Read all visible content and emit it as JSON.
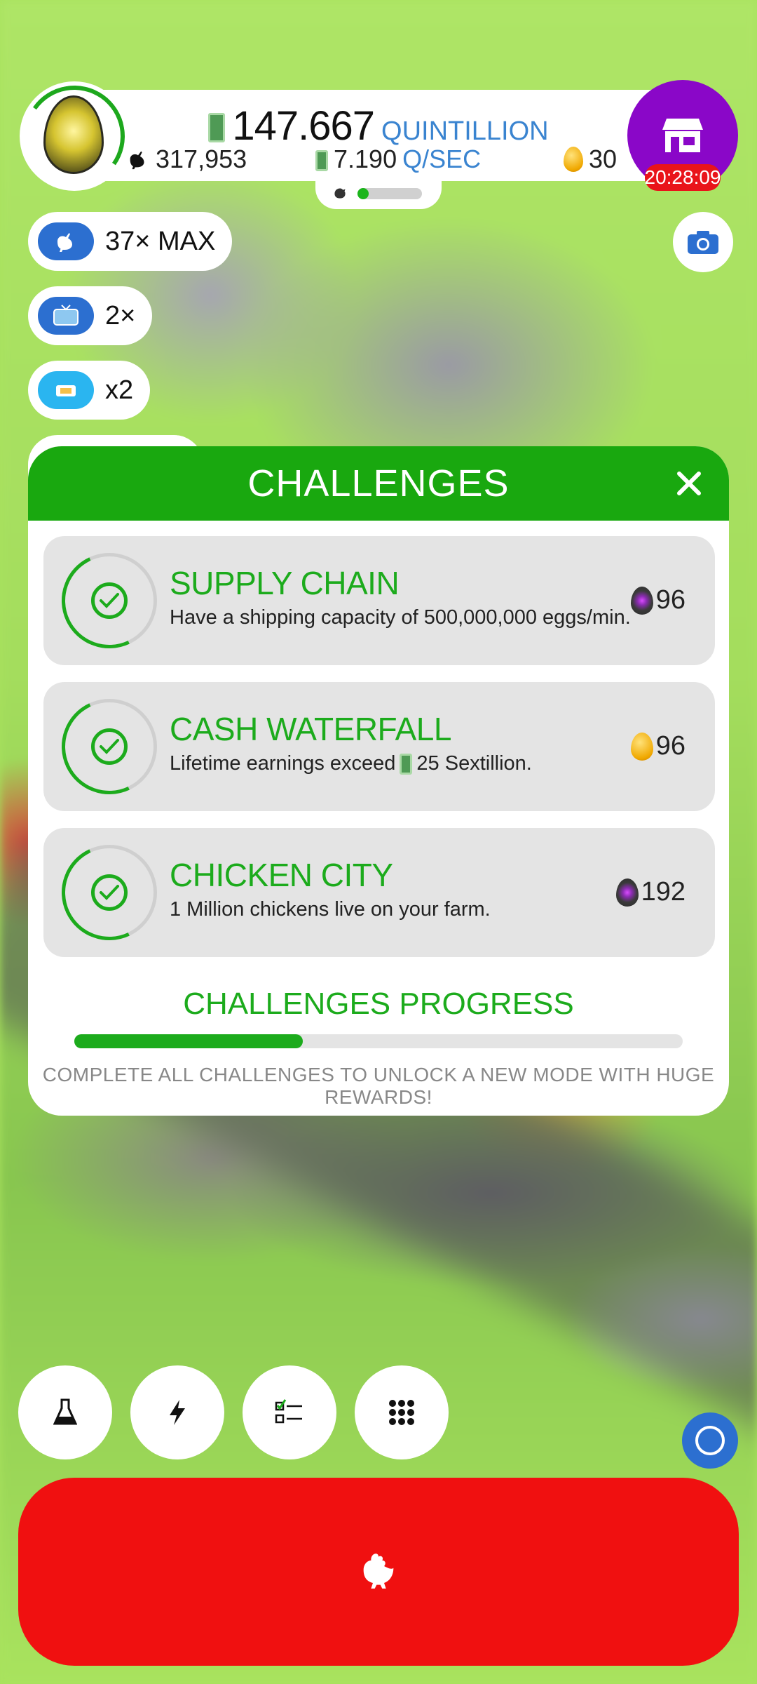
{
  "hud": {
    "money_value": "147.667",
    "money_unit": "QUINTILLION",
    "chicken_count": "317,953",
    "rate_value": "7.190",
    "rate_unit": "Q/SEC",
    "golden_eggs": "30",
    "shop_timer": "20:28:09",
    "hab_progress": 0.15
  },
  "boosts": [
    {
      "icon": "chicken-icon",
      "label": "37× MAX",
      "color": "#2c6fd0"
    },
    {
      "icon": "tv-icon",
      "label": "2×",
      "color": "#2c6fd0"
    },
    {
      "icon": "drone-icon",
      "label": "x2",
      "color": "#2ab5f0"
    }
  ],
  "challenges": {
    "title": "CHALLENGES",
    "items": [
      {
        "name": "SUPPLY CHAIN",
        "desc_before": "Have a shipping capacity of 500,000,000 eggs/min.",
        "has_cash_icon": false,
        "desc_after": "",
        "reward": "96",
        "reward_icon": "soul-egg-icon"
      },
      {
        "name": "CASH WATERFALL",
        "desc_before": "Lifetime earnings exceed",
        "has_cash_icon": true,
        "desc_after": "25 Sextillion.",
        "reward": "96",
        "reward_icon": "golden-egg-icon"
      },
      {
        "name": "CHICKEN CITY",
        "desc_before": "1 Million chickens live on your farm.",
        "has_cash_icon": false,
        "desc_after": "",
        "reward": "192",
        "reward_icon": "soul-egg-icon"
      }
    ],
    "progress_title": "CHALLENGES PROGRESS",
    "progress_fraction": 0.375,
    "progress_note": "COMPLETE ALL CHALLENGES TO UNLOCK A NEW MODE WITH HUGE REWARDS!"
  },
  "tools": [
    "research-flask-icon",
    "boost-lightning-icon",
    "checklist-icon",
    "grid-menu-icon"
  ],
  "colors": {
    "accent_green": "#1cab1c",
    "hatch_red": "#f01010",
    "shop_purple": "#8a07c8"
  }
}
